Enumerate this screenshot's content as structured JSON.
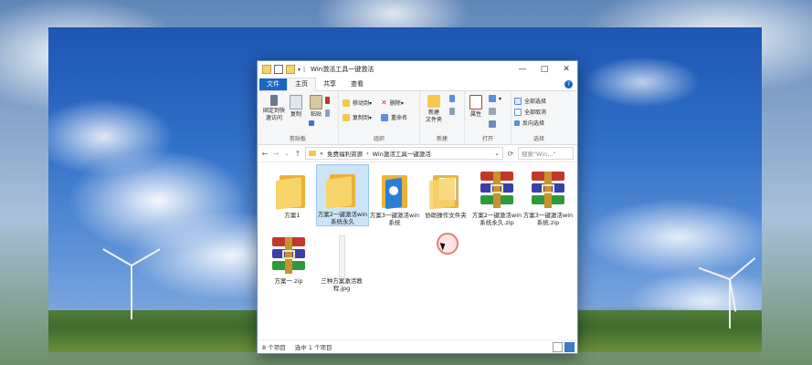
{
  "window": {
    "title": "Win激活工具一键激活",
    "controls": {
      "minimize": "—",
      "maximize": "□",
      "close": "✕"
    }
  },
  "tabs": [
    "文件",
    "主页",
    "共享",
    "查看"
  ],
  "help_label": "?",
  "ribbon": {
    "clipboard": {
      "label": "剪贴板",
      "pin": "固定到快\n速访问",
      "copy": "复制",
      "paste": "粘贴"
    },
    "organize": {
      "label": "组织",
      "move_to": "移动到▾",
      "copy_to": "复制到▾",
      "delete": "删除▾",
      "rename": "重命名"
    },
    "new": {
      "label": "新建",
      "new_folder": "新建\n文件夹"
    },
    "open": {
      "label": "打开",
      "properties": "属性"
    },
    "select": {
      "label": "选择",
      "select_all": "全部选择",
      "select_none": "全部取消",
      "invert": "反向选择"
    }
  },
  "address": {
    "back": "←",
    "forward": "→",
    "up": "↑",
    "path_root": "«",
    "path_1": "免费福利资源",
    "path_sep": "›",
    "path_2": "Win激活工具一键激活",
    "dropdown": "⌄",
    "refresh": "⟳",
    "search_placeholder": "搜索\"Win...\""
  },
  "files": [
    {
      "name": "方案1",
      "type": "folder"
    },
    {
      "name": "方案2一键激活win系统永久",
      "type": "folder",
      "selected": true
    },
    {
      "name": "方案3一键激活win系统",
      "type": "folder-blue"
    },
    {
      "name": "协助操作文件夹",
      "type": "folder-doc"
    },
    {
      "name": "方案2一键激活win系统永久.zip",
      "type": "zip"
    },
    {
      "name": "方案3一键激活win系统.zip",
      "type": "zip"
    },
    {
      "name": "方案一.zip",
      "type": "zip"
    },
    {
      "name": "三种方案激活教程.jpg",
      "type": "jpg"
    }
  ],
  "status": {
    "count": "8 个项目",
    "selected": "选中 1 个项目"
  },
  "colors": {
    "accent": "#1a66c2",
    "selection": "#cce4f7",
    "folder": "#f7d469"
  }
}
